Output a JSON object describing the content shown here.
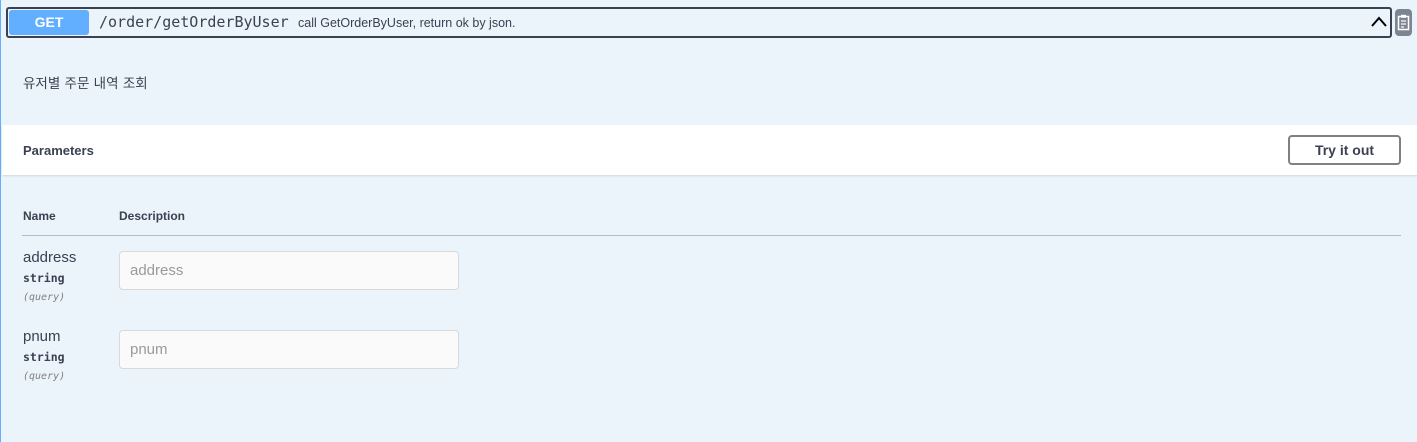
{
  "summary": {
    "method": "GET",
    "path": "/order/getOrderByUser",
    "description": "call GetOrderByUser, return ok by json."
  },
  "description": "유저별 주문 내역 조회",
  "parameters": {
    "title": "Parameters",
    "try_label": "Try it out",
    "columns": {
      "name": "Name",
      "description": "Description"
    },
    "items": [
      {
        "name": "address",
        "type": "string",
        "in": "(query)",
        "placeholder": "address",
        "value": ""
      },
      {
        "name": "pnum",
        "type": "string",
        "in": "(query)",
        "placeholder": "pnum",
        "value": ""
      }
    ]
  },
  "icons": {
    "collapse": "chevron-up-icon",
    "copy": "clipboard-copy-icon"
  },
  "colors": {
    "method_get": "#61affe",
    "block_background": "#ebf3fb",
    "text": "#3b4151"
  }
}
